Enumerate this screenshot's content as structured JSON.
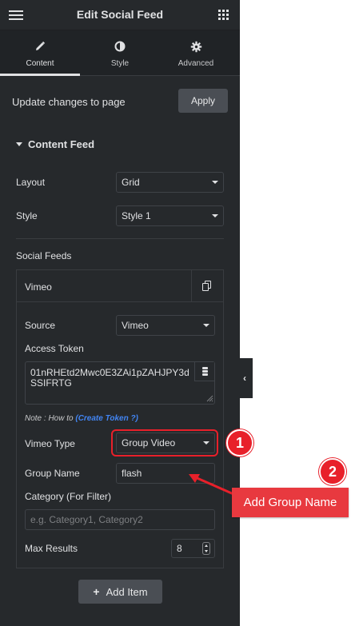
{
  "header": {
    "title": "Edit Social Feed",
    "menu_icon": "hamburger-icon",
    "apps_icon": "grid-icon"
  },
  "tabs": [
    {
      "label": "Content",
      "icon": "pencil-icon",
      "active": true
    },
    {
      "label": "Style",
      "icon": "contrast-icon",
      "active": false
    },
    {
      "label": "Advanced",
      "icon": "gear-icon",
      "active": false
    }
  ],
  "update": {
    "label": "Update changes to page",
    "button": "Apply"
  },
  "section": {
    "title": "Content Feed"
  },
  "layout": {
    "label": "Layout",
    "value": "Grid"
  },
  "style": {
    "label": "Style",
    "value": "Style 1"
  },
  "social_feeds": {
    "label": "Social Feeds",
    "item_title": "Vimeo",
    "source": {
      "label": "Source",
      "value": "Vimeo"
    },
    "access_token": {
      "label": "Access Token",
      "value": "01nRHEtd2Mwc0E3ZAi1pZAHJPY3dSSIFRTG"
    },
    "note": {
      "prefix": "Note : How to ",
      "link": "(Create Token ?)"
    },
    "vimeo_type": {
      "label": "Vimeo Type",
      "value": "Group Video"
    },
    "group_name": {
      "label": "Group Name",
      "value": "flash"
    },
    "category": {
      "label": "Category (For Filter)",
      "placeholder": "e.g. Category1, Category2"
    },
    "max_results": {
      "label": "Max Results",
      "value": "8"
    }
  },
  "add_item": {
    "label": "Add Item"
  },
  "annotations": {
    "badge_1": "1",
    "badge_2": "2",
    "callout": "Add Group Name",
    "color": "#e8202a"
  }
}
